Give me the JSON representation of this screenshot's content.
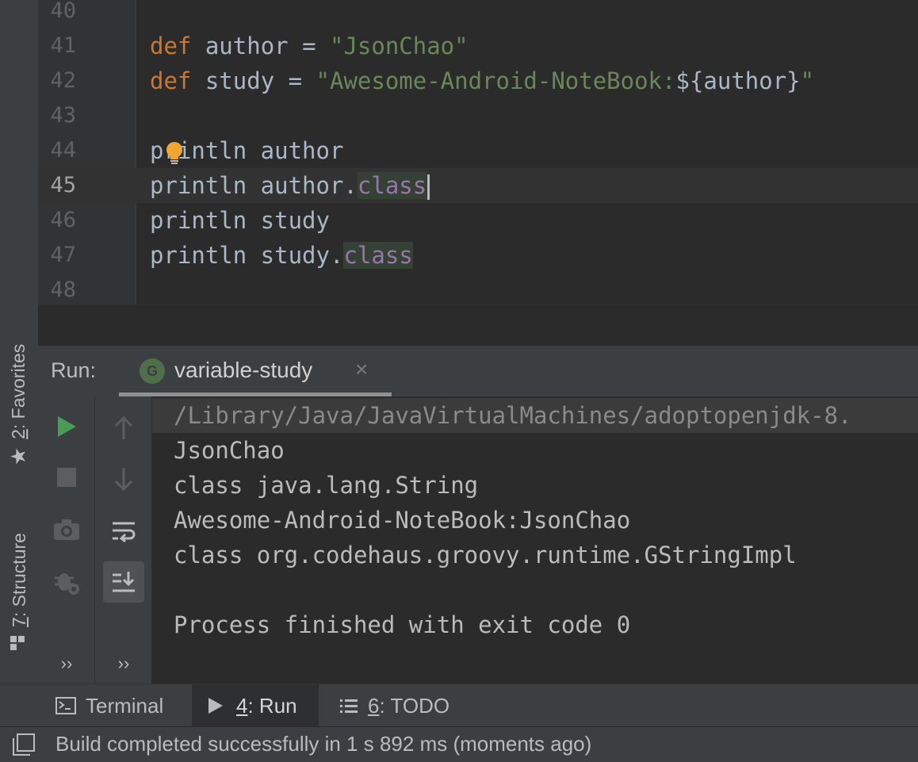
{
  "editor": {
    "lines": [
      {
        "num": "40"
      },
      {
        "num": "41",
        "kw": "def",
        "rest": " author = ",
        "str": "\"JsonChao\""
      },
      {
        "num": "42",
        "kw": "def",
        "rest": " study = ",
        "str_a": "\"Awesome-Android-NoteBook:",
        "interp": "${author}",
        "str_b": "\""
      },
      {
        "num": "43"
      },
      {
        "num": "44",
        "text": "println author"
      },
      {
        "num": "45",
        "text": "println author.",
        "prop": "class"
      },
      {
        "num": "46",
        "text": "println study"
      },
      {
        "num": "47",
        "text": "println study.",
        "prop": "class"
      },
      {
        "num": "48"
      }
    ]
  },
  "left_strip": {
    "favorites_num": "2",
    "favorites_label": ": Favorites",
    "structure_num": "7",
    "structure_label": ": Structure"
  },
  "run_panel": {
    "label": "Run:",
    "tab_title": "variable-study",
    "tab_icon_letter": "G",
    "more_chevron": "››"
  },
  "console": {
    "lines": [
      "/Library/Java/JavaVirtualMachines/adoptopenjdk-8.",
      "JsonChao",
      "class java.lang.String",
      "Awesome-Android-NoteBook:JsonChao",
      "class org.codehaus.groovy.runtime.GStringImpl",
      "",
      "Process finished with exit code 0"
    ]
  },
  "bottom_tabs": {
    "terminal": "Terminal",
    "run_num": "4",
    "run_label": ": Run",
    "todo_num": "6",
    "todo_label": ": TODO"
  },
  "status_bar": {
    "text": "Build completed successfully in 1 s 892 ms (moments ago)"
  },
  "colors": {
    "keyword": "#cc7832",
    "string": "#6a8759",
    "property": "#9876aa",
    "run_green": "#499c54",
    "bulb": "#f0a732"
  }
}
